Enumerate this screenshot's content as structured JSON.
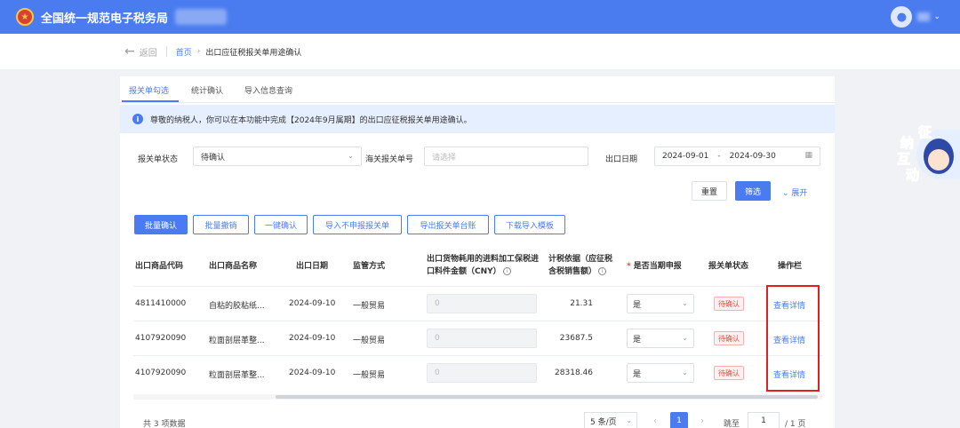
{
  "header": {
    "title": "全国统一规范电子税务局",
    "emblem_icon": "national-emblem-icon",
    "user_icon": "user-avatar-icon",
    "brand_color": "#4a7cf0"
  },
  "breadcrumb": {
    "back_label": "返回",
    "home": "首页",
    "current": "出口应征税报关单用途确认"
  },
  "tabs": [
    {
      "label": "报关单勾选",
      "active": true
    },
    {
      "label": "统计确认",
      "active": false
    },
    {
      "label": "导入信息查询",
      "active": false
    }
  ],
  "notice": {
    "text": "尊敬的纳税人，你可以在本功能中完成【2024年9月属期】的出口应征税报关单用途确认。"
  },
  "filters": {
    "status_label": "报关单状态",
    "status_value": "待确认",
    "customs_no_label": "海关报关单号",
    "customs_no_placeholder": "请选择",
    "date_label": "出口日期",
    "date_from": "2024-09-01",
    "date_to": "2024-09-30",
    "reset_label": "重置",
    "search_label": "筛选",
    "expand_label": "展开"
  },
  "actions": {
    "batch_confirm": "批量确认",
    "batch_revoke": "批量撤销",
    "one_click_confirm": "一键确认",
    "import_not_declared": "导入不申报报关单",
    "export_ledger": "导出报关单台账",
    "download_template": "下载导入模板"
  },
  "table": {
    "headers": {
      "code": "出口商品代码",
      "name": "出口商品名称",
      "date": "出口日期",
      "method": "监管方式",
      "amount": "出口货物耗用的进料加工保税进口料件金额（CNY）",
      "basis": "计税依据（应征税含税销售额）",
      "declare": "是否当期申报",
      "status": "报关单状态",
      "ops": "操作栏"
    },
    "rows": [
      {
        "code": "4811410000",
        "name": "自粘的胶粘纸...",
        "date": "2024-09-10",
        "method": "一般贸易",
        "amount": "0",
        "basis": "21.31",
        "declare": "是",
        "status": "待确认",
        "action": "查看详情"
      },
      {
        "code": "4107920090",
        "name": "粒面剖层革整...",
        "date": "2024-09-10",
        "method": "一般贸易",
        "amount": "0",
        "basis": "23687.5",
        "declare": "是",
        "status": "待确认",
        "action": "查看详情"
      },
      {
        "code": "4107920090",
        "name": "粒面剖层革整...",
        "date": "2024-09-10",
        "method": "一般贸易",
        "amount": "0",
        "basis": "28318.46",
        "declare": "是",
        "status": "待确认",
        "action": "查看详情"
      }
    ]
  },
  "pagination": {
    "total_text": "共 3 项数据",
    "page_size": "5 条/页",
    "current_page": "1",
    "jump_label": "跳至",
    "jump_value": "1",
    "total_pages": "/ 1 页"
  },
  "mascot": {
    "chars": [
      "征",
      "纳",
      "互",
      "动"
    ]
  }
}
